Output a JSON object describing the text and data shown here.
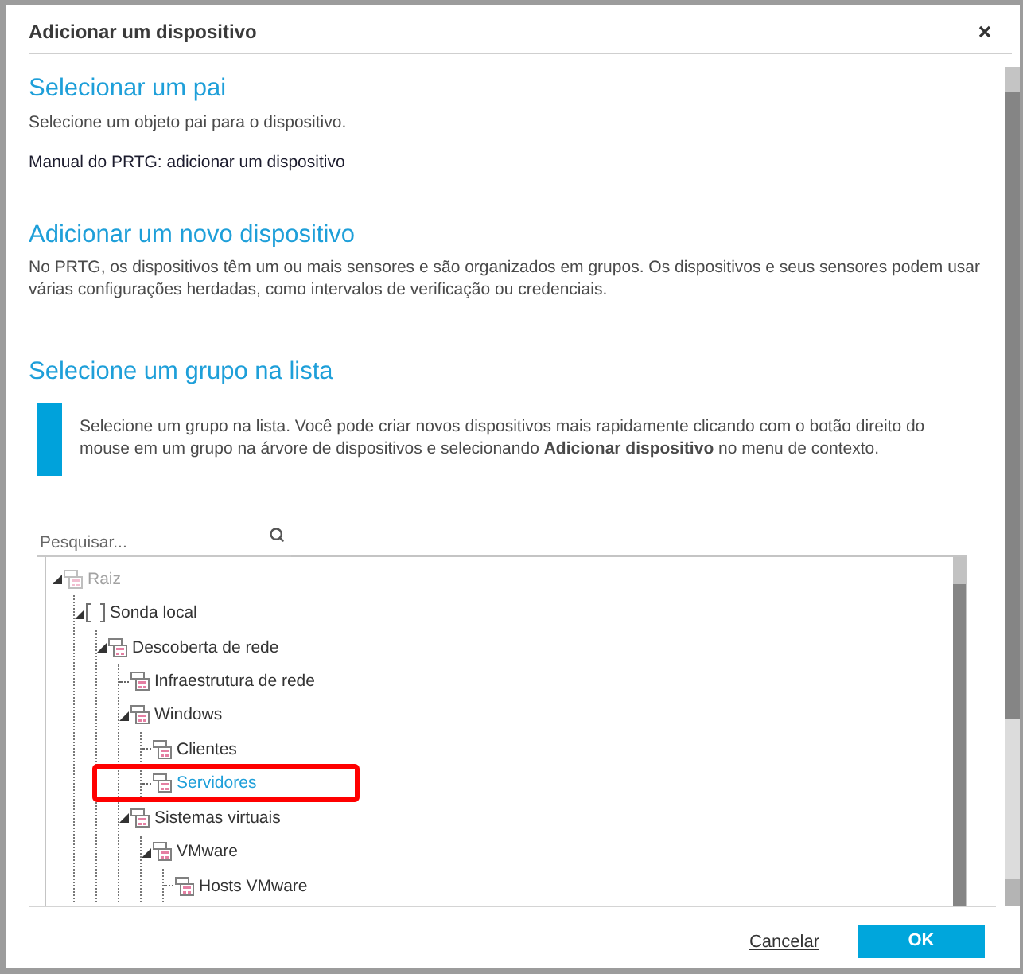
{
  "dialog": {
    "title": "Adicionar um dispositivo"
  },
  "parent_section": {
    "heading": "Selecionar um pai",
    "text": "Selecione um objeto pai para o dispositivo.",
    "link": "Manual do PRTG: adicionar um dispositivo"
  },
  "device_section": {
    "heading": "Adicionar um novo dispositivo",
    "text": "No PRTG, os dispositivos têm um ou mais sensores e são organizados em grupos. Os dispositivos e seus sensores podem usar várias configurações herdadas, como intervalos de verificação ou credenciais."
  },
  "group_section": {
    "heading": "Selecione um grupo na lista",
    "info": "Selecione um grupo na lista. Você pode criar novos dispositivos mais rapidamente clicando com o botão direito do mouse em um grupo na árvore de dispositivos e selecionando **Adicionar dispositivo** no menu de contexto."
  },
  "search": {
    "placeholder": "Pesquisar..."
  },
  "tree": [
    {
      "label": "Raiz",
      "kind": "group",
      "disabled": true,
      "selected": false,
      "highlighted": false,
      "expanded": true,
      "children": [
        {
          "label": "Sonda local",
          "kind": "probe",
          "disabled": false,
          "selected": false,
          "highlighted": false,
          "expanded": true,
          "children": [
            {
              "label": "Descoberta de rede",
              "kind": "group",
              "disabled": false,
              "selected": false,
              "highlighted": false,
              "expanded": true,
              "children": [
                {
                  "label": "Infraestrutura de rede",
                  "kind": "group",
                  "disabled": false,
                  "selected": false,
                  "highlighted": false
                },
                {
                  "label": "Windows",
                  "kind": "group",
                  "disabled": false,
                  "selected": false,
                  "highlighted": false,
                  "expanded": true,
                  "children": [
                    {
                      "label": "Clientes",
                      "kind": "group",
                      "disabled": false,
                      "selected": false,
                      "highlighted": false
                    },
                    {
                      "label": "Servidores",
                      "kind": "group",
                      "disabled": false,
                      "selected": true,
                      "highlighted": true
                    }
                  ]
                },
                {
                  "label": "Sistemas virtuais",
                  "kind": "group",
                  "disabled": false,
                  "selected": false,
                  "highlighted": false,
                  "expanded": true,
                  "children": [
                    {
                      "label": "VMware",
                      "kind": "group",
                      "disabled": false,
                      "selected": false,
                      "highlighted": false,
                      "expanded": true,
                      "children": [
                        {
                          "label": "Hosts VMware",
                          "kind": "group",
                          "disabled": false,
                          "selected": false,
                          "highlighted": false
                        }
                      ]
                    }
                  ]
                }
              ]
            }
          ]
        }
      ]
    }
  ],
  "footer": {
    "cancel": "Cancelar",
    "ok": "OK"
  }
}
